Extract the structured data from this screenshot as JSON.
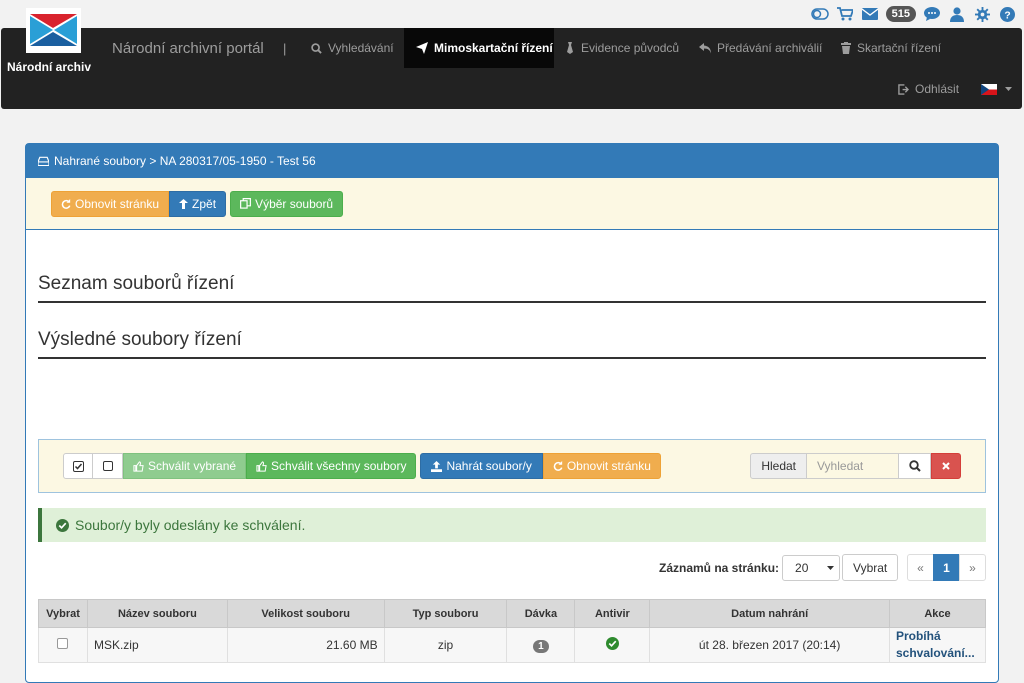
{
  "topbar": {
    "message_count": "515"
  },
  "navbar": {
    "logo_text": "Národní archiv",
    "brand": "Národní archivní portál",
    "separator": "|",
    "items": [
      {
        "label": "Vyhledávání"
      },
      {
        "label": "Mimoskartační řízení"
      },
      {
        "label": "Evidence původců"
      },
      {
        "label": "Předávání archiválií"
      },
      {
        "label": "Skartační řízení"
      }
    ],
    "logout": "Odhlásit"
  },
  "panel": {
    "heading": "Nahrané soubory > NA 280317/05-1950 - Test 56",
    "toolbar": {
      "refresh": "Obnovit stránku",
      "back": "Zpět",
      "select_files": "Výběr souborů"
    },
    "section1": "Seznam souborů řízení",
    "section2": "Výsledné soubory řízení",
    "filterbar": {
      "approve_selected": "Schválit vybrané",
      "approve_all": "Schválit všechny soubory",
      "upload": "Nahrát soubor/y",
      "refresh": "Obnovit stránku",
      "search_label": "Hledat",
      "search_placeholder": "Vyhledat"
    },
    "alert": "Soubor/y byly odeslány ke schválení.",
    "pagination": {
      "per_page_label": "Záznamů na stránku:",
      "per_page_value": "20",
      "select_button": "Vybrat",
      "prev": "«",
      "current": "1",
      "next": "»"
    },
    "table": {
      "headers": [
        "Vybrat",
        "Název souboru",
        "Velikost souboru",
        "Typ souboru",
        "Dávka",
        "Antivir",
        "Datum nahrání",
        "Akce"
      ],
      "rows": [
        {
          "name": "MSK.zip",
          "size": "21.60 MB",
          "type": "zip",
          "batch": "1",
          "date": "út 28. březen 2017 (20:14)",
          "action": "Probíhá schvalování..."
        }
      ]
    }
  },
  "colors": {
    "primary": "#337ab7",
    "warning": "#f0ad4e",
    "success": "#5cb85c",
    "danger": "#d9534f",
    "navbar": "#222222"
  }
}
